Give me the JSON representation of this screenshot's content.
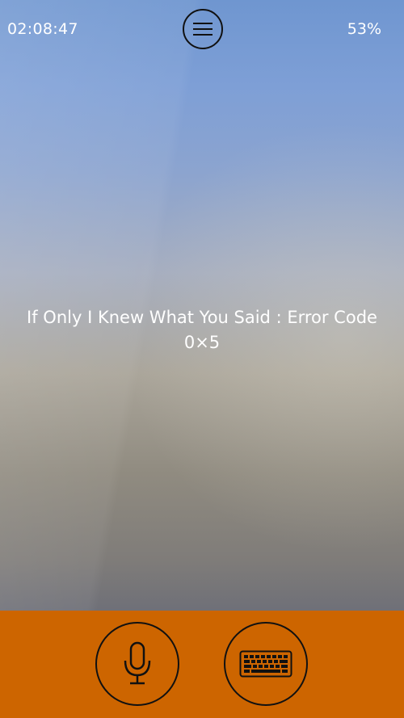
{
  "status_bar": {
    "time": "02:08:47",
    "battery": "53%"
  },
  "header": {
    "menu_icon": "hamburger-menu-icon"
  },
  "main": {
    "message_line1": "If Only I Knew What You Said : Error Code",
    "message_line2": "0×5"
  },
  "bottom_bar": {
    "background_color": "#cd6500",
    "buttons": [
      {
        "icon": "microphone-icon"
      },
      {
        "icon": "keyboard-icon"
      }
    ]
  }
}
